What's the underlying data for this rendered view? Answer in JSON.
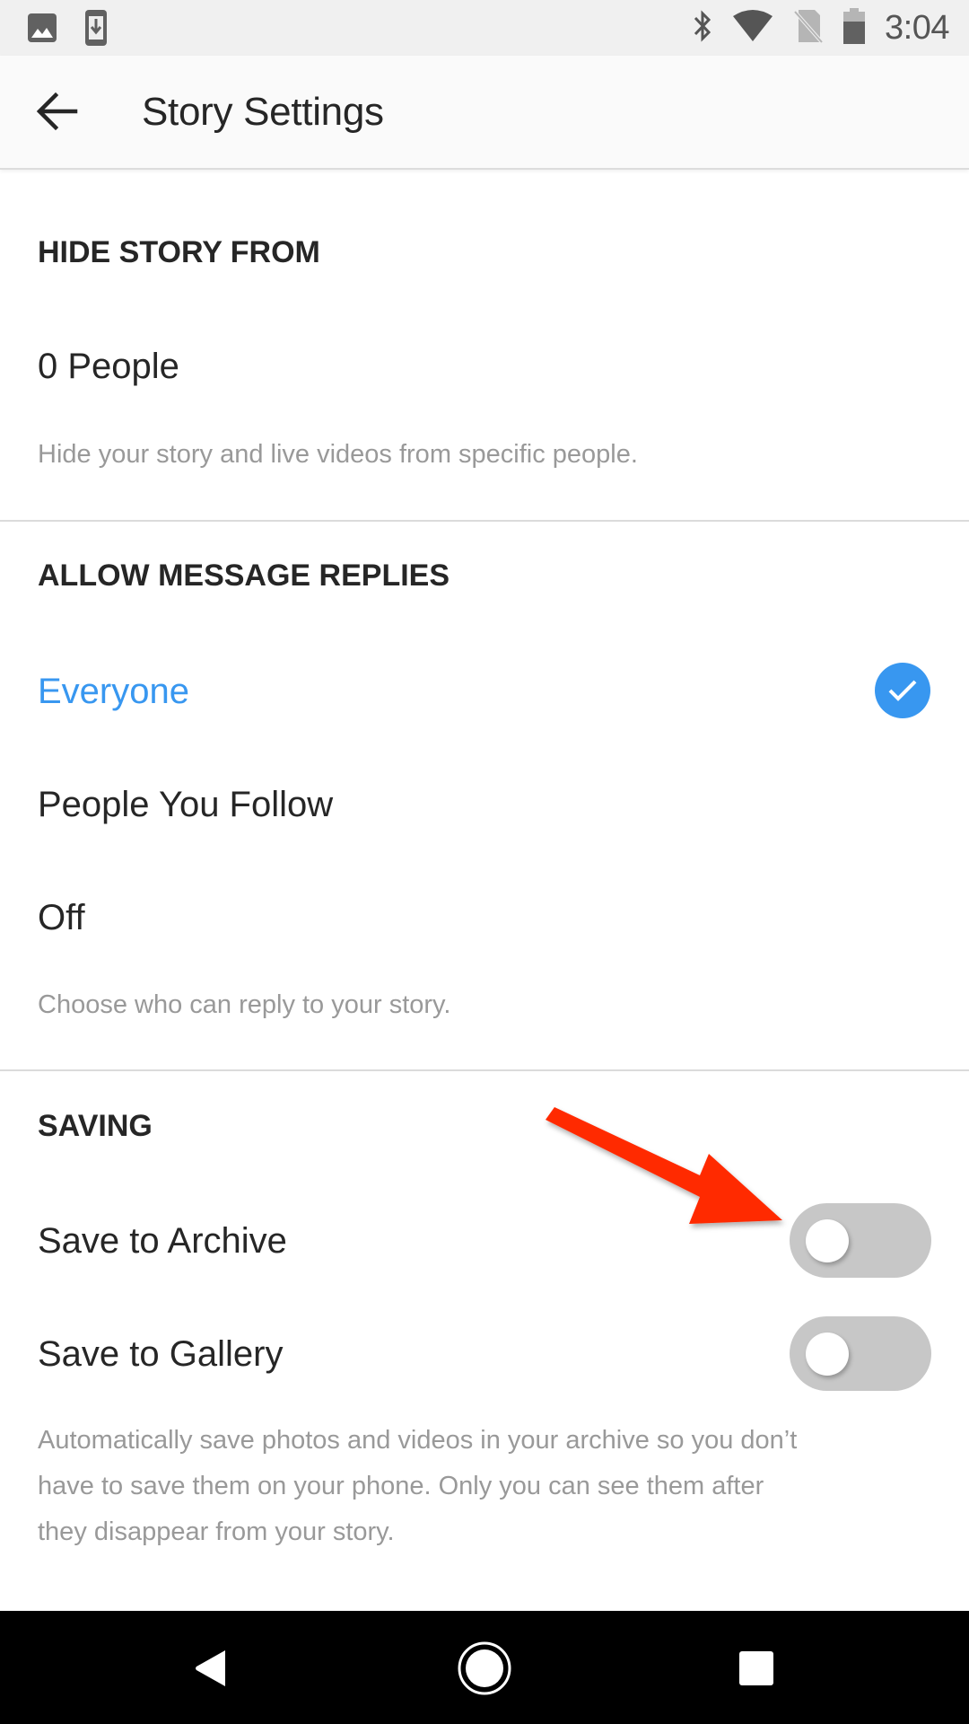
{
  "status_bar": {
    "time": "3:04",
    "left_icons": [
      "image-notification-icon",
      "download-notification-icon"
    ],
    "right_icons": [
      "bluetooth-icon",
      "wifi-icon",
      "no-sim-icon",
      "battery-icon"
    ]
  },
  "header": {
    "title": "Story Settings",
    "back_icon": "arrow-left-icon"
  },
  "sections": {
    "hide_story": {
      "title": "HIDE STORY FROM",
      "value_label": "0 People",
      "hint": "Hide your story and live videos from specific people."
    },
    "message_replies": {
      "title": "ALLOW MESSAGE REPLIES",
      "options": [
        {
          "label": "Everyone",
          "selected": true
        },
        {
          "label": "People You Follow",
          "selected": false
        },
        {
          "label": "Off",
          "selected": false
        }
      ],
      "hint": "Choose who can reply to your story."
    },
    "saving": {
      "title": "SAVING",
      "toggles": [
        {
          "label": "Save to Archive",
          "on": false
        },
        {
          "label": "Save to Gallery",
          "on": false
        }
      ],
      "hint_lines": [
        "Automatically save photos and videos in your archive so you don’t",
        "have to save them on your phone. Only you can see them after",
        "they disappear from your story."
      ]
    }
  },
  "annotation": {
    "type": "arrow",
    "color": "#ff2a00",
    "points_to": "Save to Archive toggle"
  },
  "colors": {
    "accent": "#3897f0",
    "toggle_off": "#c7c7c7",
    "hint_text": "#999999"
  },
  "nav_bar": {
    "buttons": [
      "back",
      "home",
      "recents"
    ]
  }
}
